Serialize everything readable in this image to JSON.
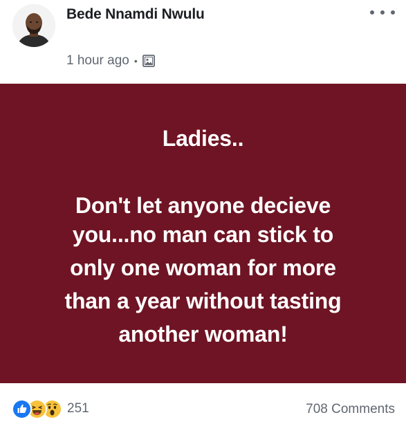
{
  "post": {
    "author_name": "Bede Nnamdi Nwulu",
    "timestamp": "1 hour ago",
    "separator": "•",
    "audience_icon": "photo-album-icon",
    "more_icon": "more-options-icon",
    "background_color": "#6f1424",
    "text_color": "#ffffff",
    "text_lines": [
      "Ladies..",
      "Don't let anyone decieve",
      "you...no man can stick to",
      "only one woman for more",
      "than a year without tasting",
      "another woman!"
    ]
  },
  "footer": {
    "reaction_icons": [
      "like-icon",
      "haha-icon",
      "wow-icon"
    ],
    "reaction_count": "251",
    "comments": "708 Comments"
  }
}
